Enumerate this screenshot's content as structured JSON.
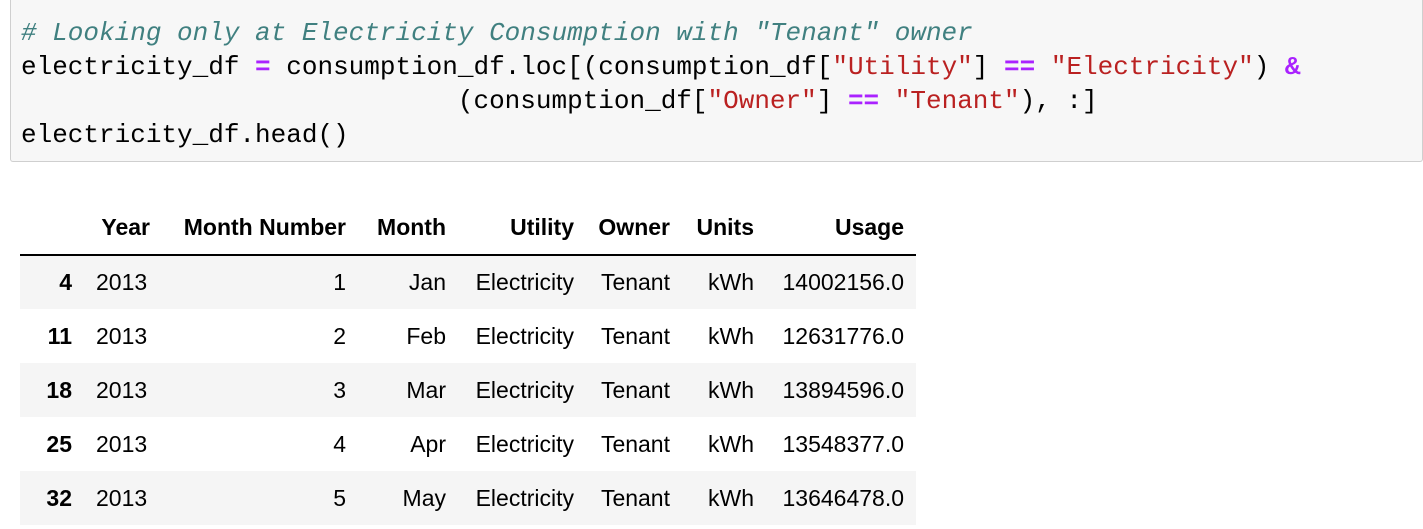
{
  "code_cell": {
    "comment": "# Looking only at Electricity Consumption with \"Tenant\" owner",
    "line2": {
      "var": "electricity_df ",
      "assign": "=",
      "expr1": " consumption_df.loc[(consumption_df[",
      "str1": "\"Utility\"",
      "mid1": "] ",
      "eq1": "==",
      "sp1": " ",
      "str2": "\"Electricity\"",
      "mid2": ") ",
      "amp": "&"
    },
    "line3": {
      "indent": "                            ",
      "expr": "(consumption_df[",
      "str1": "\"Owner\"",
      "mid": "] ",
      "eq": "==",
      "sp": " ",
      "str2": "\"Tenant\"",
      "end": "), :]"
    },
    "line4": "electricity_df.head()"
  },
  "output_table": {
    "columns": [
      "",
      "Year",
      "Month Number",
      "Month",
      "Utility",
      "Owner",
      "Units",
      "Usage"
    ],
    "rows": [
      {
        "index": "4",
        "year": "2013",
        "month_number": "1",
        "month": "Jan",
        "utility": "Electricity",
        "owner": "Tenant",
        "units": "kWh",
        "usage": "14002156.0"
      },
      {
        "index": "11",
        "year": "2013",
        "month_number": "2",
        "month": "Feb",
        "utility": "Electricity",
        "owner": "Tenant",
        "units": "kWh",
        "usage": "12631776.0"
      },
      {
        "index": "18",
        "year": "2013",
        "month_number": "3",
        "month": "Mar",
        "utility": "Electricity",
        "owner": "Tenant",
        "units": "kWh",
        "usage": "13894596.0"
      },
      {
        "index": "25",
        "year": "2013",
        "month_number": "4",
        "month": "Apr",
        "utility": "Electricity",
        "owner": "Tenant",
        "units": "kWh",
        "usage": "13548377.0"
      },
      {
        "index": "32",
        "year": "2013",
        "month_number": "5",
        "month": "May",
        "utility": "Electricity",
        "owner": "Tenant",
        "units": "kWh",
        "usage": "13646478.0"
      }
    ]
  }
}
